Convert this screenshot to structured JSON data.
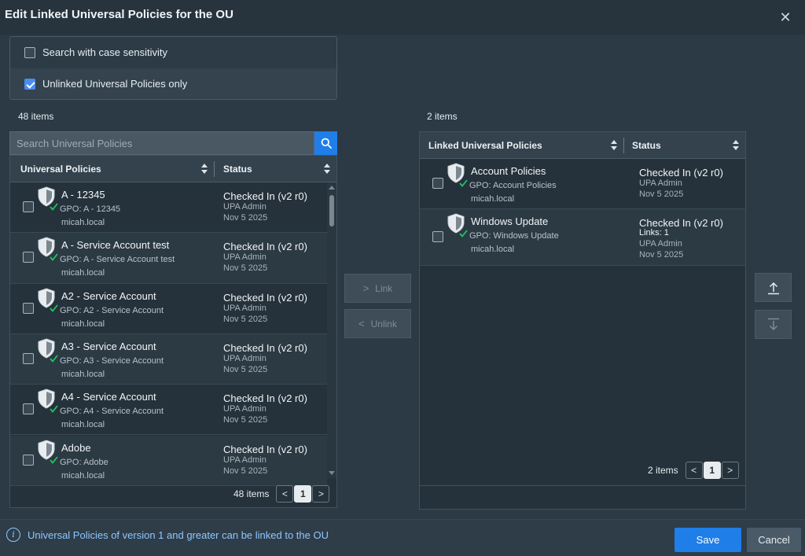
{
  "dialog": {
    "title": "Edit Linked Universal Policies for the OU",
    "close_icon": "close-icon"
  },
  "options": {
    "case_sensitivity": {
      "label": "Search with case sensitivity",
      "checked": false
    },
    "unlinked_only": {
      "label": "Unlinked Universal Policies only",
      "checked": true
    }
  },
  "left": {
    "count_label": "48 items",
    "search_placeholder": "Search Universal Policies",
    "columns": [
      "Universal Policies",
      "Status"
    ],
    "rows": [
      {
        "name": "A - 12345",
        "gpo": "GPO: A - 12345",
        "domain": "micah.local",
        "status": "Checked In (v2 r0)",
        "user": "UPA Admin",
        "date": "Nov 5 2025"
      },
      {
        "name": "A - Service Account test",
        "gpo": "GPO: A - Service Account test",
        "domain": "micah.local",
        "status": "Checked In (v2 r0)",
        "user": "UPA Admin",
        "date": "Nov 5 2025"
      },
      {
        "name": "A2 - Service Account",
        "gpo": "GPO: A2 - Service Account",
        "domain": "micah.local",
        "status": "Checked In (v2 r0)",
        "user": "UPA Admin",
        "date": "Nov 5 2025"
      },
      {
        "name": "A3 - Service Account",
        "gpo": "GPO: A3 - Service Account",
        "domain": "micah.local",
        "status": "Checked In (v2 r0)",
        "user": "UPA Admin",
        "date": "Nov 5 2025"
      },
      {
        "name": "A4 - Service Account",
        "gpo": "GPO: A4 - Service Account",
        "domain": "micah.local",
        "status": "Checked In (v2 r0)",
        "user": "UPA Admin",
        "date": "Nov 5 2025"
      },
      {
        "name": "Adobe",
        "gpo": "GPO: Adobe",
        "domain": "micah.local",
        "status": "Checked In (v2 r0)",
        "user": "UPA Admin",
        "date": "Nov 5 2025"
      }
    ],
    "pager": {
      "count": "48 items",
      "prev": "<",
      "page": "1",
      "next": ">"
    }
  },
  "middle": {
    "link_label": "Link",
    "unlink_label": "Unlink",
    "link_chevron": ">",
    "unlink_chevron": "<"
  },
  "right": {
    "count_label": "2 items",
    "columns": [
      "Linked Universal Policies",
      "Status"
    ],
    "rows": [
      {
        "name": "Account Policies",
        "gpo": "GPO: Account Policies",
        "domain": "micah.local",
        "status": "Checked In (v2 r0)",
        "links": "",
        "user": "UPA Admin",
        "date": "Nov 5 2025"
      },
      {
        "name": "Windows Update",
        "gpo": "GPO: Windows Update",
        "domain": "micah.local",
        "status": "Checked In (v2 r0)",
        "links": "Links: 1",
        "user": "UPA Admin",
        "date": "Nov 5 2025"
      }
    ],
    "pager": {
      "count": "2 items",
      "prev": "<",
      "page": "1",
      "next": ">"
    }
  },
  "footer": {
    "info_text": "Universal Policies of version 1 and greater can be linked to the OU",
    "save_label": "Save",
    "cancel_label": "Cancel"
  },
  "colors": {
    "accent": "#1f7ee8",
    "check_green": "#22c55e",
    "info_blue": "#8fc6ff"
  }
}
